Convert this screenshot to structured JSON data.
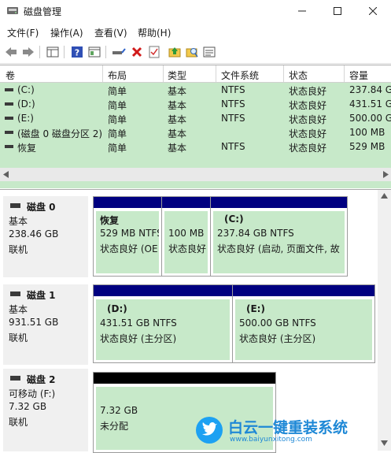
{
  "window": {
    "title": "磁盘管理"
  },
  "menu": [
    "文件(F)",
    "操作(A)",
    "查看(V)",
    "帮助(H)"
  ],
  "columns": [
    "卷",
    "布局",
    "类型",
    "文件系统",
    "状态",
    "容量"
  ],
  "volumes": [
    {
      "name": "(C:)",
      "layout": "简单",
      "type": "基本",
      "fs": "NTFS",
      "status": "状态良好",
      "capacity": "237.84 G"
    },
    {
      "name": "(D:)",
      "layout": "简单",
      "type": "基本",
      "fs": "NTFS",
      "status": "状态良好",
      "capacity": "431.51 G"
    },
    {
      "name": "(E:)",
      "layout": "简单",
      "type": "基本",
      "fs": "NTFS",
      "status": "状态良好",
      "capacity": "500.00 G"
    },
    {
      "name": "(磁盘 0 磁盘分区 2)",
      "layout": "简单",
      "type": "基本",
      "fs": "",
      "status": "状态良好",
      "capacity": "100 MB"
    },
    {
      "name": "恢复",
      "layout": "简单",
      "type": "基本",
      "fs": "NTFS",
      "status": "状态良好",
      "capacity": "529 MB"
    }
  ],
  "disks": [
    {
      "name": "磁盘 0",
      "kind": "基本",
      "size": "238.46 GB",
      "state": "联机",
      "partitions": [
        {
          "label": "恢复",
          "size": "529 MB NTFS",
          "status": "状态良好 (OE"
        },
        {
          "label": "",
          "size": "100 MB",
          "status": "状态良好"
        },
        {
          "label": "(C:)",
          "size": "237.84 GB NTFS",
          "status": "状态良好 (启动, 页面文件, 故"
        }
      ]
    },
    {
      "name": "磁盘 1",
      "kind": "基本",
      "size": "931.51 GB",
      "state": "联机",
      "partitions": [
        {
          "label": "(D:)",
          "size": "431.51 GB NTFS",
          "status": "状态良好 (主分区)"
        },
        {
          "label": "(E:)",
          "size": "500.00 GB NTFS",
          "status": "状态良好 (主分区)"
        }
      ]
    },
    {
      "name": "磁盘 2",
      "kind": "可移动 (F:)",
      "size": "7.32 GB",
      "state": "联机",
      "partitions": [
        {
          "label": "",
          "size": "7.32 GB",
          "status": "未分配"
        }
      ]
    }
  ],
  "watermark": {
    "brand": "白云一键重装系统",
    "url": "www.baiyunxitong.com"
  },
  "colors": {
    "healthy": "#c7e9c9",
    "primary_bar": "#000080",
    "unallocated_bar": "#000000"
  }
}
